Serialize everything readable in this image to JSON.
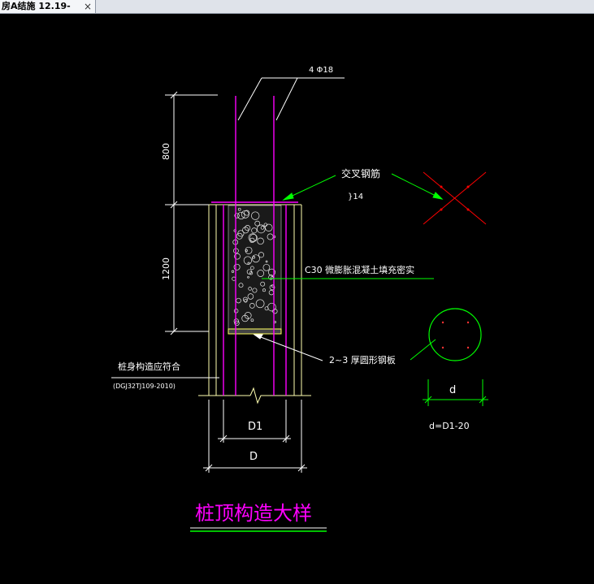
{
  "tab": {
    "title": "房A结施 12.19-",
    "close_glyph": "×"
  },
  "drawing": {
    "rebar_top_label": "4 Φ18",
    "dim_800": "800",
    "dim_1200": "1200",
    "cross_rebar_label": "交叉钢筋",
    "cross_rebar_spec": "}14",
    "concrete_label": "C30  微膨胀混凝土填充密实",
    "plate_label": "2~3  厚圆形钢板",
    "pile_body_label": "桩身构造应符合",
    "pile_body_std": "(DGJ32TJ109-2010)",
    "dim_D1": "D1",
    "dim_D": "D",
    "dim_d": "d",
    "formula": "d=D1-20",
    "title": "桩顶构造大样"
  },
  "colors": {
    "background": "#000000",
    "magenta": "#ff00ff",
    "yellow_line": "#ffff80",
    "green": "#00ff00",
    "white": "#ffffff",
    "red": "#ff0000"
  }
}
